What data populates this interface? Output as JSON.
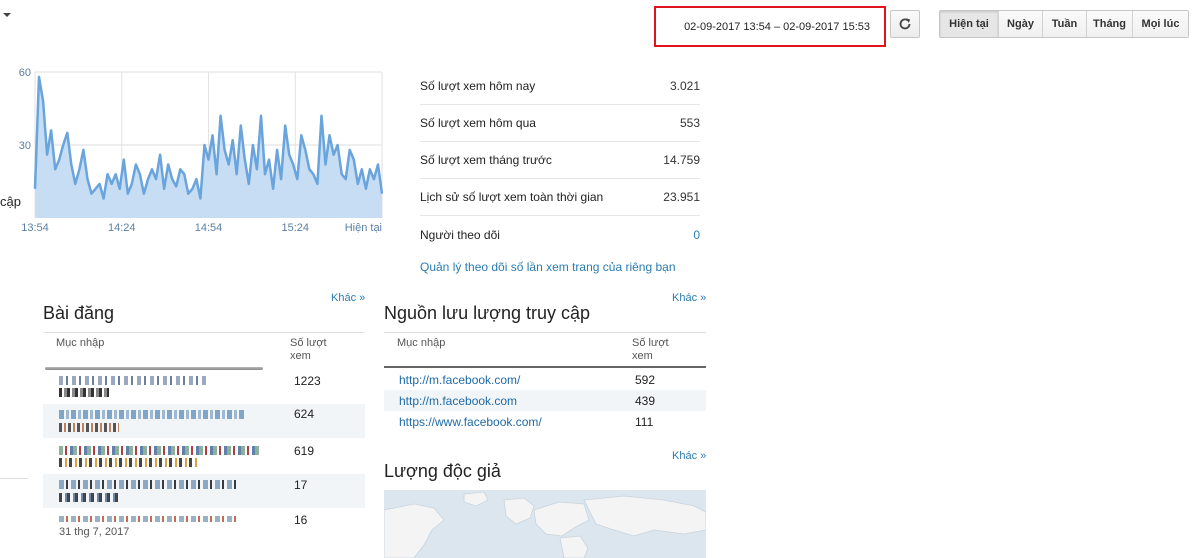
{
  "header": {
    "date_range": "02-09-2017 13:54 – 02-09-2017 15:53",
    "range_buttons": [
      {
        "label": "Hiện tại",
        "active": true
      },
      {
        "label": "Ngày",
        "active": false
      },
      {
        "label": "Tuần",
        "active": false
      },
      {
        "label": "Tháng",
        "active": false
      },
      {
        "label": "Mọi lúc",
        "active": false
      }
    ],
    "refresh_icon": "refresh-icon",
    "caret_icon": "caret-down-icon"
  },
  "chart_data": {
    "type": "area",
    "title": "",
    "ylabel": "cập",
    "y_ticks": [
      "60",
      "30"
    ],
    "x_ticks": [
      "13:54",
      "14:24",
      "14:54",
      "15:24",
      "Hiện tại"
    ],
    "ylim": [
      0,
      60
    ],
    "color": "#6aa4dc",
    "fill": "#c6ddf4",
    "values": [
      12,
      58,
      48,
      26,
      36,
      20,
      24,
      30,
      35,
      22,
      14,
      20,
      28,
      16,
      10,
      12,
      14,
      8,
      18,
      14,
      18,
      12,
      24,
      10,
      14,
      22,
      18,
      10,
      16,
      20,
      16,
      26,
      12,
      22,
      16,
      13,
      20,
      18,
      10,
      12,
      16,
      8,
      30,
      24,
      34,
      18,
      42,
      28,
      22,
      32,
      18,
      38,
      24,
      14,
      30,
      20,
      42,
      18,
      24,
      12,
      28,
      16,
      38,
      26,
      22,
      16,
      34,
      28,
      20,
      18,
      14,
      42,
      22,
      34,
      26,
      30,
      18,
      16,
      28,
      24,
      14,
      20,
      12,
      20,
      16,
      22,
      10
    ],
    "grid": true
  },
  "stats": [
    {
      "label": "Số lượt xem hôm nay",
      "value": "3.021"
    },
    {
      "label": "Số lượt xem hôm qua",
      "value": "553"
    },
    {
      "label": "Số lượt xem tháng trước",
      "value": "14.759"
    },
    {
      "label": "Lịch sử số lượt xem toàn thời gian",
      "value": "23.951"
    },
    {
      "label": "Người theo dõi",
      "value": "0"
    }
  ],
  "manage_link": "Quản lý theo dõi số lần xem trang của riêng bạn",
  "posts": {
    "title": "Bài đăng",
    "more": "Khác »",
    "col_entry": "Mục nhập",
    "col_views": "Số lượt xem",
    "rows": [
      {
        "views": "1223"
      },
      {
        "views": "624"
      },
      {
        "views": "619"
      },
      {
        "views": "17"
      },
      {
        "views": "16"
      }
    ],
    "footer_partial": "31 thg 7, 2017"
  },
  "traffic": {
    "title": "Nguồn lưu lượng truy cập",
    "more": "Khác »",
    "col_entry": "Mục nhập",
    "col_views": "Số lượt xem",
    "rows": [
      {
        "url": "http://m.facebook.com/",
        "views": "592"
      },
      {
        "url": "http://m.facebook.com",
        "views": "439"
      },
      {
        "url": "https://www.facebook.com/",
        "views": "111"
      }
    ]
  },
  "audience": {
    "title": "Lượng độc giả",
    "more": "Khác »"
  }
}
